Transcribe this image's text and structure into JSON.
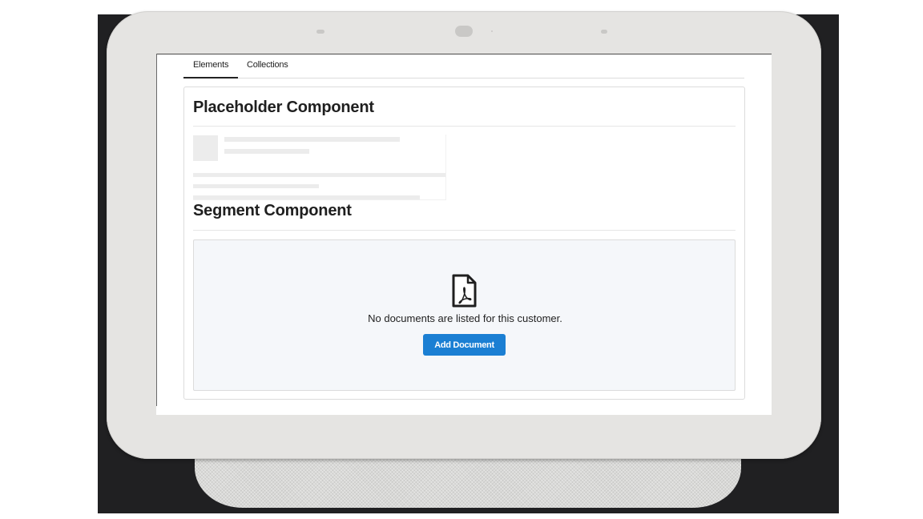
{
  "tabs": [
    {
      "label": "Elements",
      "active": true
    },
    {
      "label": "Collections",
      "active": false
    }
  ],
  "placeholder_section": {
    "title": "Placeholder Component"
  },
  "segment_section": {
    "title": "Segment Component",
    "empty_state": {
      "icon": "pdf-document-icon",
      "message": "No documents are listed for this customer.",
      "button_label": "Add Document"
    }
  },
  "colors": {
    "accent": "#1b7fd3",
    "backdrop": "#202022",
    "device_bezel": "#e5e4e2",
    "panel_background": "#f5f7fa"
  }
}
